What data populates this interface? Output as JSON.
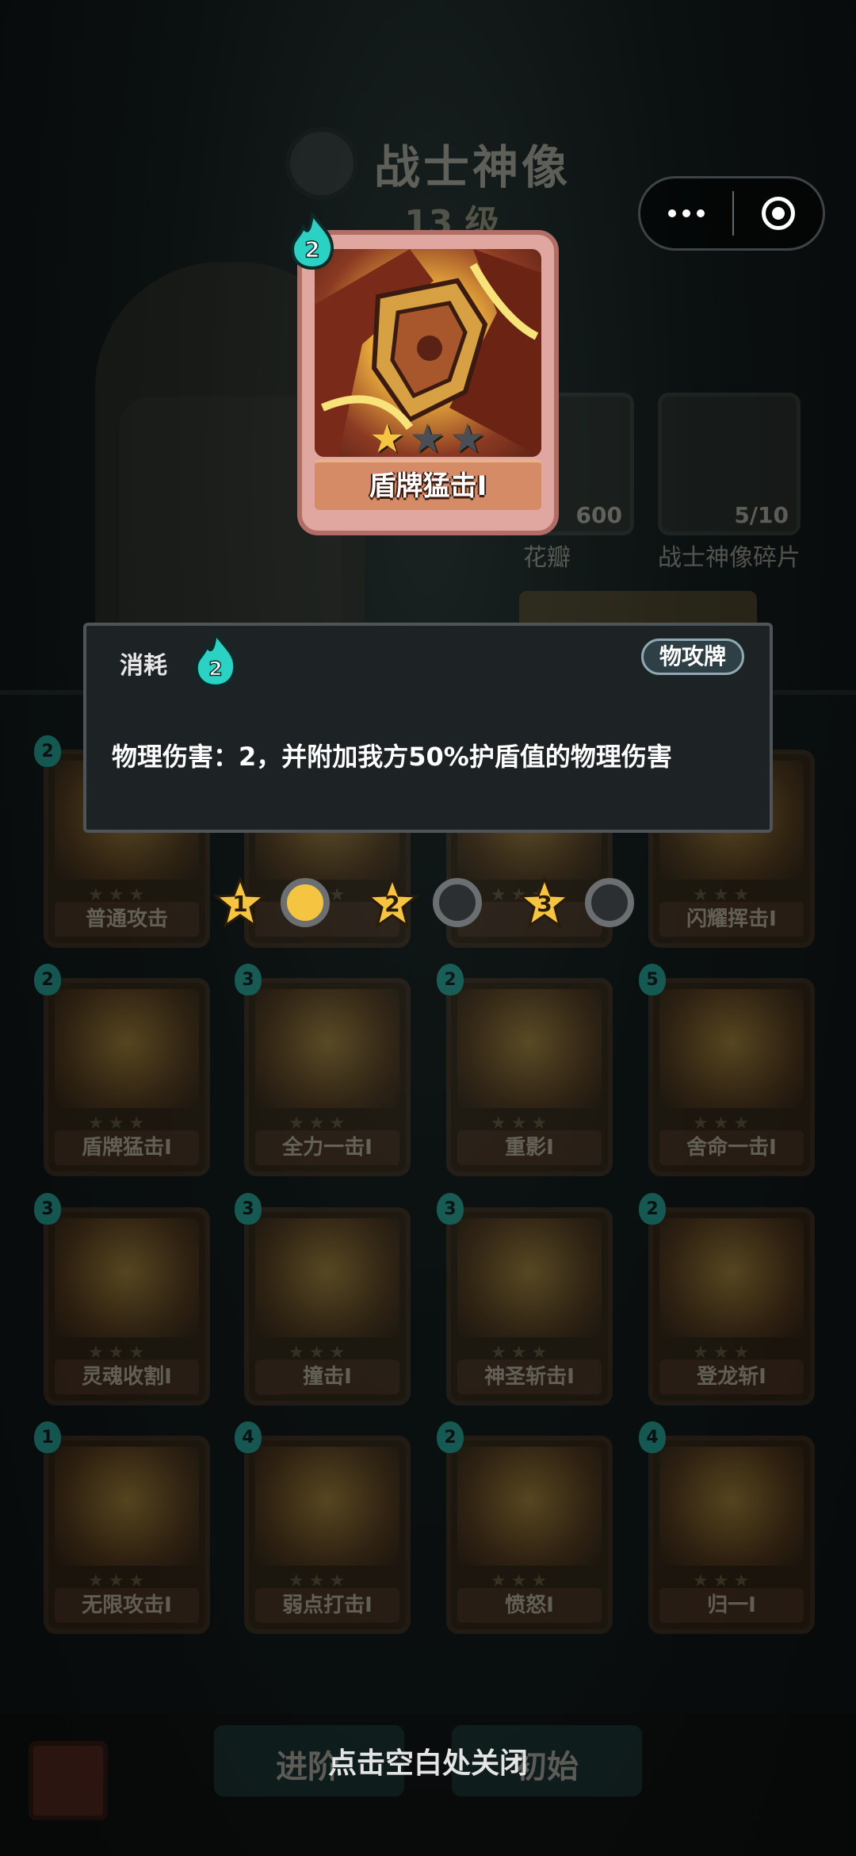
{
  "background": {
    "title": "战士神像",
    "level": "13 级",
    "resources": [
      {
        "label": "花瓣",
        "count": "600"
      },
      {
        "label": "战士神像碎片",
        "count": "5/10"
      }
    ],
    "cards": [
      {
        "name": "普通攻击",
        "cost": "2"
      },
      {
        "name": "",
        "cost": ""
      },
      {
        "name": "",
        "cost": ""
      },
      {
        "name": "闪耀挥击I",
        "cost": ""
      },
      {
        "name": "盾牌猛击I",
        "cost": "2"
      },
      {
        "name": "全力一击I",
        "cost": "3"
      },
      {
        "name": "重影I",
        "cost": "2"
      },
      {
        "name": "舍命一击I",
        "cost": "5"
      },
      {
        "name": "灵魂收割I",
        "cost": "3"
      },
      {
        "name": "撞击I",
        "cost": "3"
      },
      {
        "name": "神圣斩击I",
        "cost": "3"
      },
      {
        "name": "登龙斩I",
        "cost": "2"
      },
      {
        "name": "无限攻击I",
        "cost": "1"
      },
      {
        "name": "弱点打击I",
        "cost": "4"
      },
      {
        "name": "愤怒I",
        "cost": "2"
      },
      {
        "name": "归一I",
        "cost": "4"
      }
    ],
    "bottom_left": "进阶",
    "bottom_right": "初始"
  },
  "selected_card": {
    "name": "盾牌猛击I",
    "cost": "2",
    "stars_filled": 1,
    "stars_total": 3
  },
  "info_panel": {
    "cost_label": "消耗",
    "cost": "2",
    "type_tag": "物攻牌",
    "description": "物理伤害：2，并附加我方50%护盾值的物理伤害"
  },
  "level_selector": [
    {
      "label": "1",
      "selected": true
    },
    {
      "label": "2",
      "selected": false
    },
    {
      "label": "3",
      "selected": false
    }
  ],
  "close_hint": "点击空白处关闭",
  "colors": {
    "accent_teal": "#2bd1c3",
    "star_gold": "#f5c542",
    "panel_bg": "#1d2225"
  }
}
